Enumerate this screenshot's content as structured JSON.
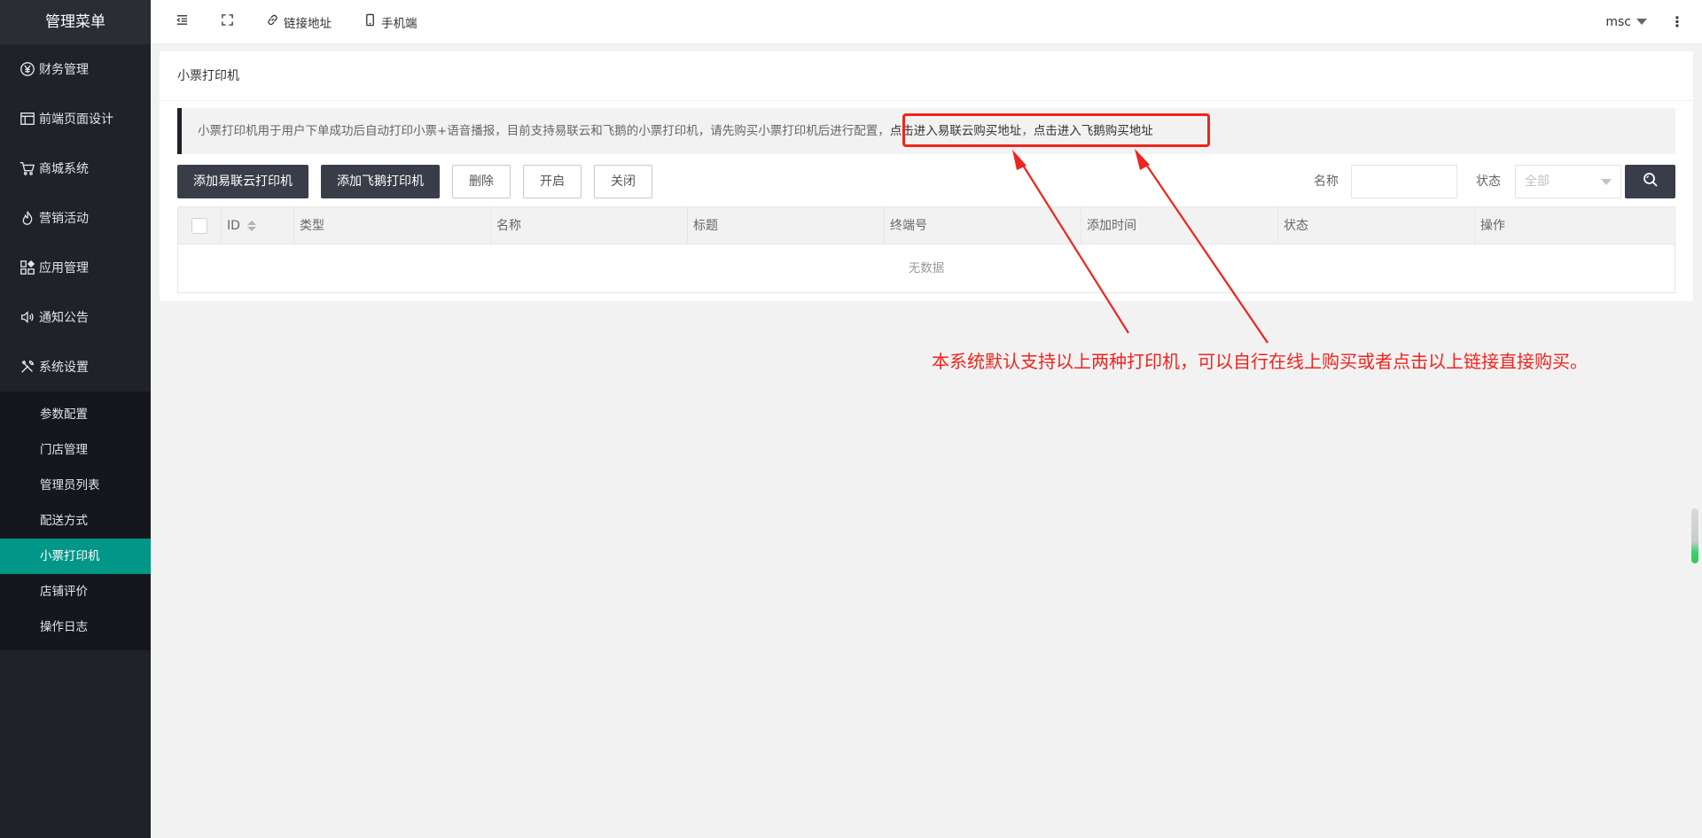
{
  "sidebar": {
    "title": "管理菜单",
    "items": [
      {
        "label": "财务管理",
        "icon": "yen-circle-icon"
      },
      {
        "label": "前端页面设计",
        "icon": "layout-icon"
      },
      {
        "label": "商城系统",
        "icon": "cart-icon"
      },
      {
        "label": "营销活动",
        "icon": "fire-icon"
      },
      {
        "label": "应用管理",
        "icon": "apps-icon"
      },
      {
        "label": "通知公告",
        "icon": "speaker-icon"
      },
      {
        "label": "系统设置",
        "icon": "tools-icon"
      }
    ],
    "submenu": [
      {
        "label": "参数配置"
      },
      {
        "label": "门店管理"
      },
      {
        "label": "管理员列表"
      },
      {
        "label": "配送方式"
      },
      {
        "label": "小票打印机"
      },
      {
        "label": "店铺评价"
      },
      {
        "label": "操作日志"
      }
    ],
    "active_sub": "小票打印机",
    "active_color": "#009688"
  },
  "header": {
    "link_label": "链接地址",
    "mobile_label": "手机端",
    "user": "msc"
  },
  "page": {
    "title": "小票打印机",
    "notice_text": "小票打印机用于用户下单成功后自动打印小票+语音播报，目前支持易联云和飞鹅的小票打印机，请先购买小票打印机后进行配置，",
    "notice_link1": "点击进入易联云购买地址",
    "notice_sep": "，",
    "notice_link2": "点击进入飞鹅购买地址"
  },
  "toolbar": {
    "add_yilianyun": "添加易联云打印机",
    "add_feie": "添加飞鹅打印机",
    "delete": "删除",
    "open": "开启",
    "close": "关闭",
    "name_label": "名称",
    "name_value": "",
    "status_label": "状态",
    "status_value": "全部"
  },
  "table": {
    "columns": [
      "ID",
      "类型",
      "名称",
      "标题",
      "终端号",
      "添加时间",
      "状态",
      "操作"
    ],
    "rows": [],
    "empty_text": "无数据"
  },
  "annotation": {
    "text": "本系统默认支持以上两种打印机，可以自行在线上购买或者点击以上链接直接购买。",
    "color": "#f0241d"
  }
}
